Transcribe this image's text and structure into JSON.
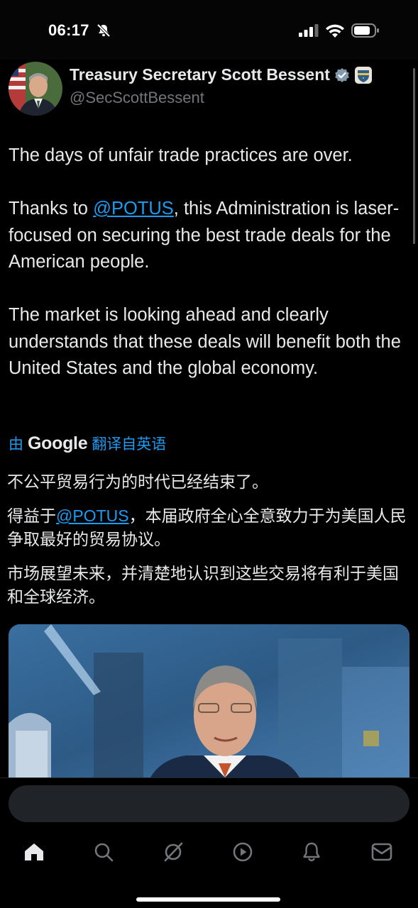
{
  "status_bar": {
    "time": "06:17",
    "icons": [
      "bell-slash-icon",
      "cellular-signal-icon",
      "wifi-icon",
      "battery-icon"
    ]
  },
  "tweet": {
    "display_name": "Treasury Secretary Scott Bessent",
    "handle": "@SecScottBessent",
    "badges": [
      "verified-badge-icon",
      "treasury-seal-icon"
    ],
    "paragraphs": [
      {
        "text_before": "The days of unfair trade practices are over.",
        "mention": "",
        "text_after": ""
      },
      {
        "text_before": "Thanks to ",
        "mention": "@POTUS",
        "text_after": ", this Administration is laser-focused on securing the best trade deals for the American people."
      },
      {
        "text_before": "The market is looking ahead and clearly understands that these deals will benefit both the United States and the global economy.",
        "mention": "",
        "text_after": ""
      }
    ]
  },
  "translation": {
    "prefix": "由",
    "provider": "Google",
    "suffix": "翻译自英语",
    "paragraphs": [
      {
        "text_before": "不公平贸易行为的时代已经结束了。",
        "mention": "",
        "text_after": ""
      },
      {
        "text_before": "得益于",
        "mention": "@POTUS",
        "text_after": "，本届政府全心全意致力于为美国人民争取最好的贸易协议。"
      },
      {
        "text_before": "市场展望未来，并清楚地认识到这些交易将有利于美国和全球经济。",
        "mention": "",
        "text_after": ""
      }
    ]
  },
  "media": {
    "kind": "video-thumbnail"
  },
  "reply": {
    "placeholder": ""
  },
  "nav": {
    "items": [
      "home-icon",
      "search-icon",
      "grok-icon",
      "video-icon",
      "notifications-icon",
      "messages-icon"
    ]
  },
  "colors": {
    "background": "#000000",
    "text": "#e7e9ea",
    "secondary_text": "#71767b",
    "accent": "#1d9bf0"
  }
}
